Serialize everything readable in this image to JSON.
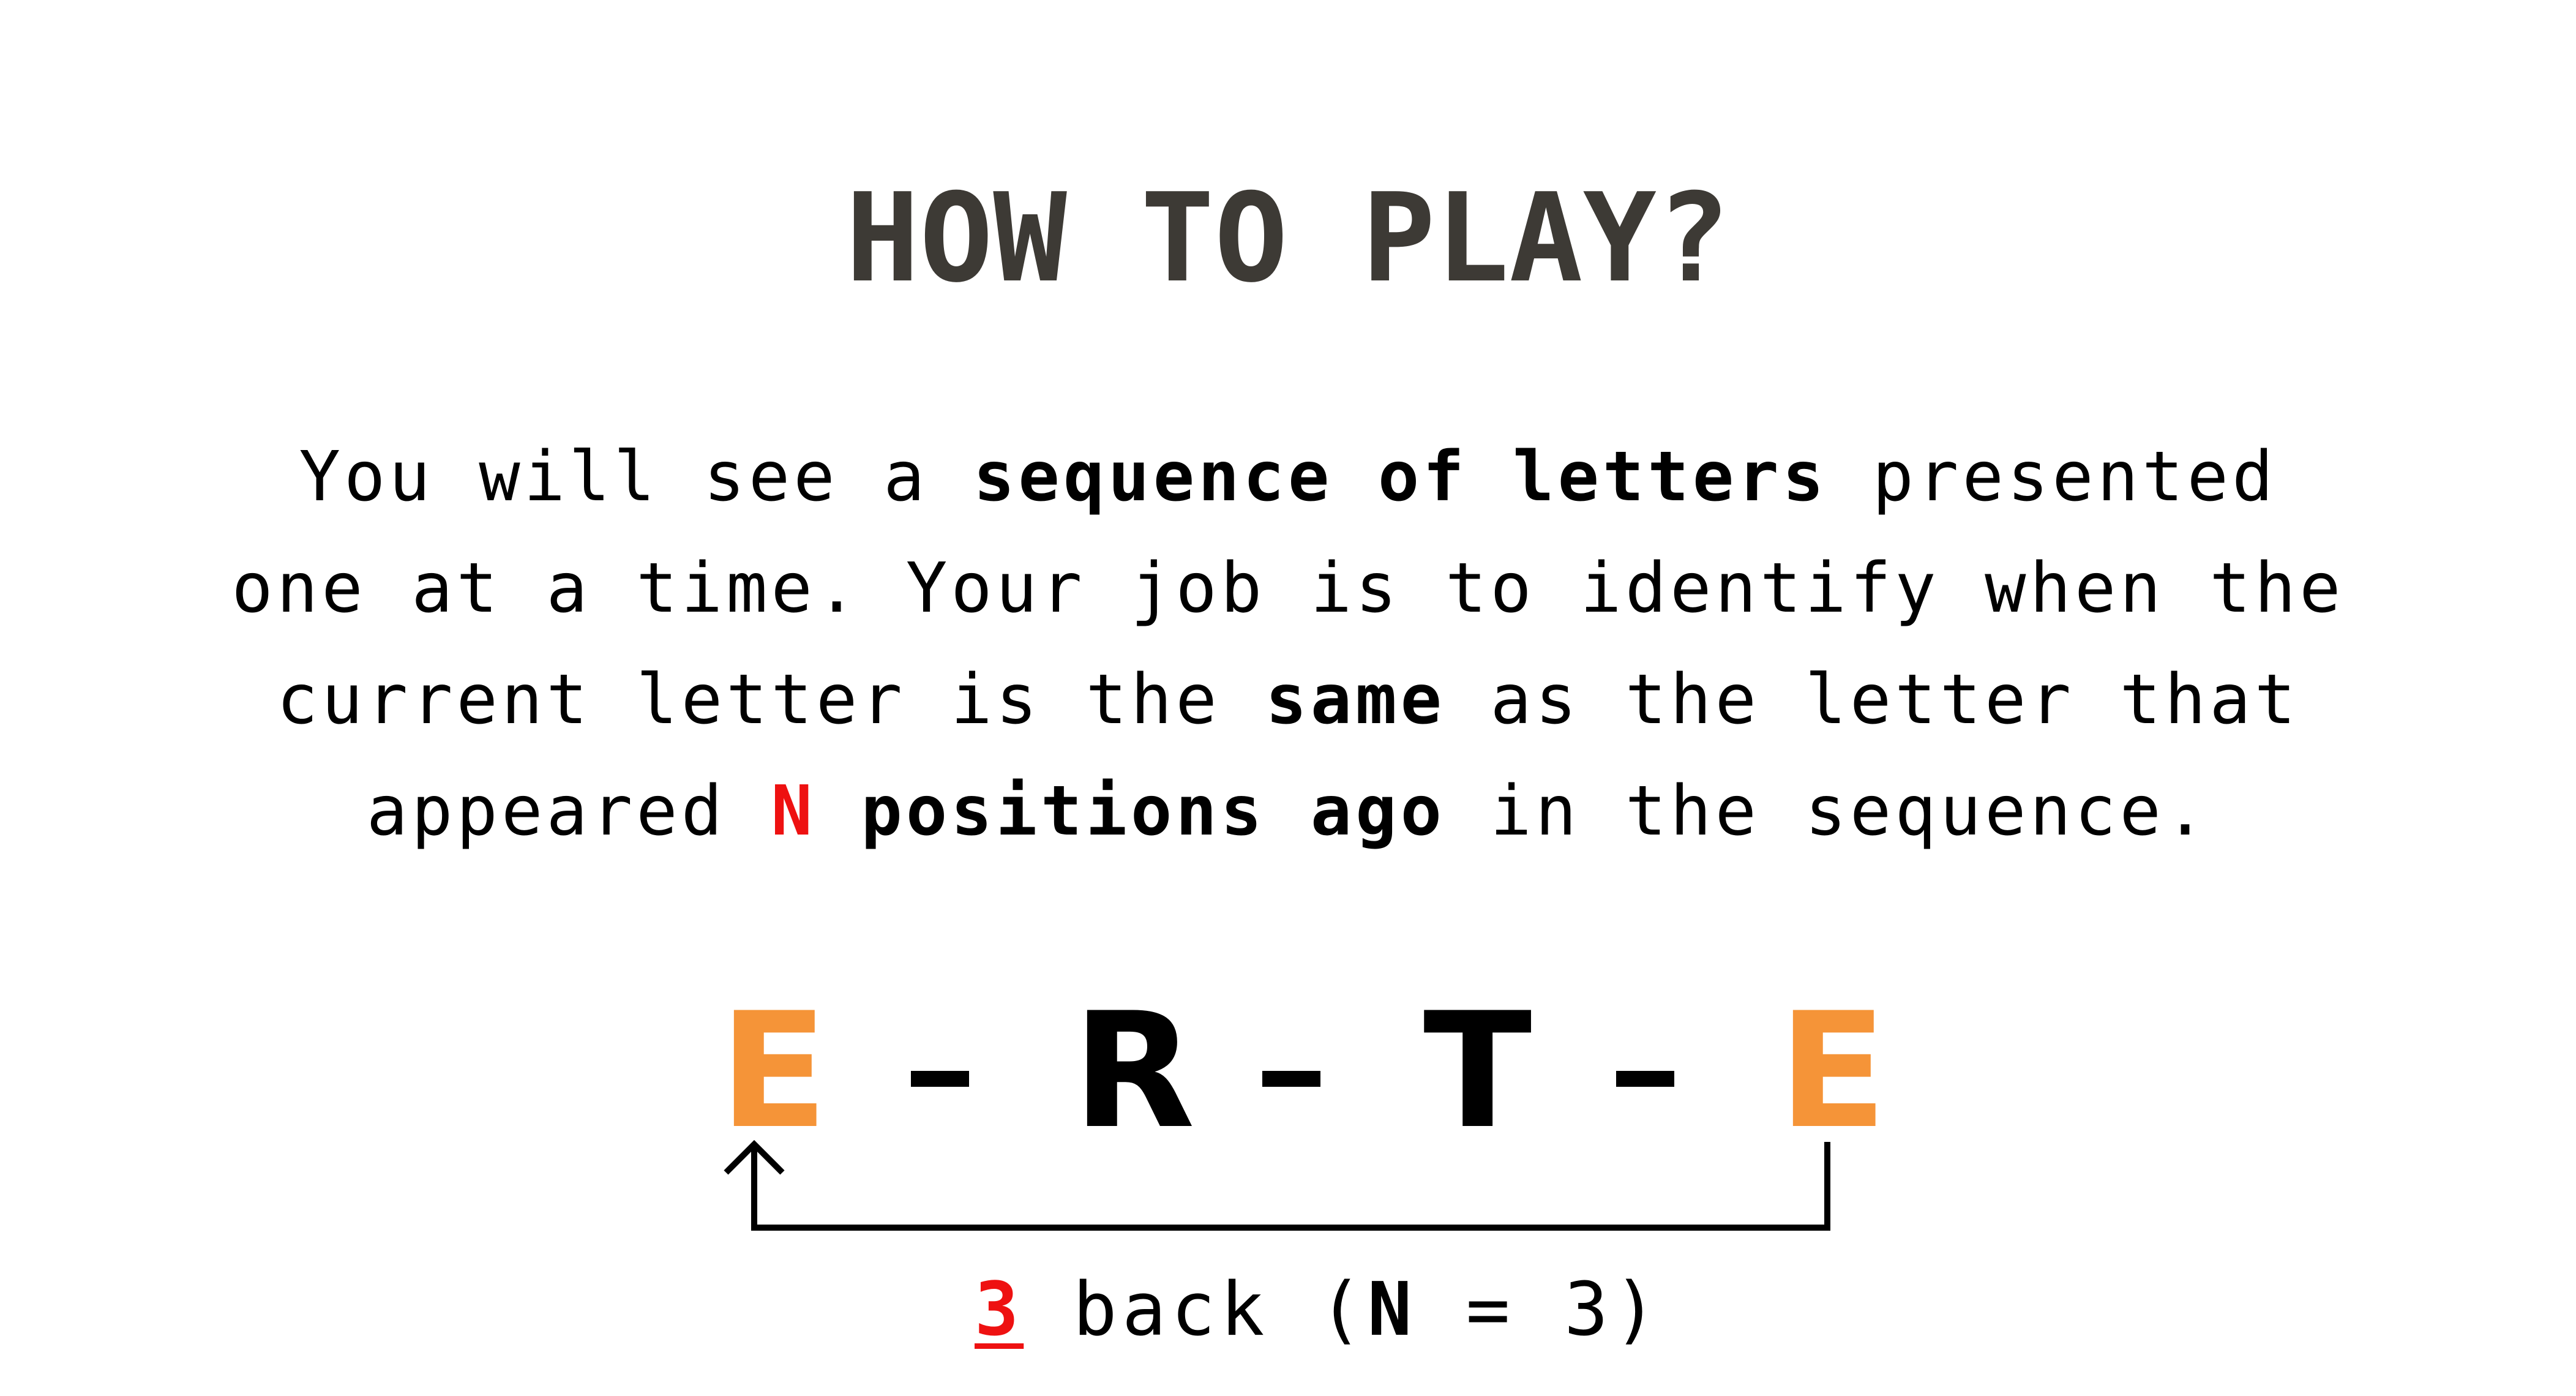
{
  "title": "HOW TO PLAY?",
  "instructions": {
    "line1_a": "You will see a ",
    "line1_bold": "sequence of letters",
    "line1_b": " presented",
    "line2": "one at a time. Your job is to identify when the",
    "line3_a": "current letter is the ",
    "line3_bold": "same",
    "line3_b": " as the letter that",
    "line4_a": "appeared ",
    "line4_n": "N",
    "line4_bold": " positions ago",
    "line4_b": " in the sequence."
  },
  "example": {
    "letters": [
      "E",
      "R",
      "T",
      "E"
    ],
    "caption_number": "3",
    "caption_text_a": " back (",
    "caption_n": "N",
    "caption_text_b": " = 3)"
  },
  "colors": {
    "title": "#3d3a35",
    "highlight_red": "#ee1111",
    "match_orange": "#f59438"
  },
  "icons": [
    "up-arrow-icon"
  ]
}
